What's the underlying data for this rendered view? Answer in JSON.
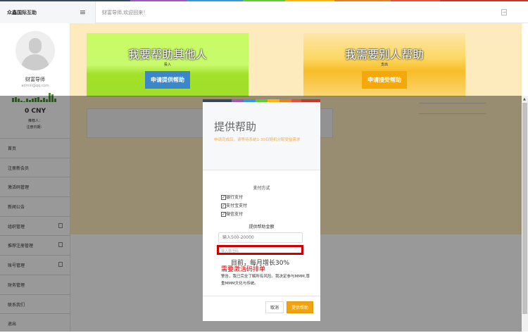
{
  "app": {
    "logo": "众鑫国际互助",
    "welcome": "财富导师,欢迎回来！"
  },
  "colors": {
    "stripe": [
      "#34495e",
      "#9b59b6",
      "#3498db",
      "#62cb31",
      "#ffb606",
      "#e67e22",
      "#e74c3c",
      "#c0392b"
    ],
    "green_button": "#3b87c9",
    "orange_button": "#f5a80a"
  },
  "user": {
    "name": "财富导师",
    "email": "admin@qq.com",
    "balance": "0 CNY",
    "referrer": "推荐人：",
    "reg_date": "注册日期：",
    "activity_bars": [
      5,
      6,
      4,
      1,
      0,
      4,
      2,
      4,
      5,
      6,
      2,
      5,
      3,
      12,
      10,
      4
    ]
  },
  "sidebar": {
    "items": [
      {
        "label": "首页"
      },
      {
        "label": "注册新会员"
      },
      {
        "label": "激活码管理"
      },
      {
        "label": "新闻公告"
      },
      {
        "label": "组织管理",
        "badge": true
      },
      {
        "label": "推荐注册管理",
        "badge": true
      },
      {
        "label": "账号管理",
        "badge": true
      },
      {
        "label": "财务管理"
      },
      {
        "label": "联系我们"
      },
      {
        "label": "退出"
      }
    ]
  },
  "cards": {
    "give": {
      "title": "我要帮助其他人",
      "sub": "投入",
      "button": "申请提供帮助"
    },
    "get": {
      "title": "我需要别人帮助",
      "sub": "支出",
      "button": "申请接受帮助"
    }
  },
  "modal": {
    "title": "提供帮助",
    "notice": "申请完成后，请等待系统1-30日随机分配受益需求",
    "payment_title": "支付方式",
    "payments": [
      {
        "label": "银行支付",
        "checked": true
      },
      {
        "label": "支付宝支付",
        "checked": true
      },
      {
        "label": "微信支付",
        "checked": true
      }
    ],
    "amount_label": "提供帮助金额",
    "amount_placeholder": "输入500-20000",
    "code_placeholder": "输入激活码",
    "growth": "目前，每月增长30%",
    "need_code": "需要激活码排单",
    "warning": "警告，我已完全了解所有风险。我决定参与MMM,尊重MMM文化与传统。",
    "cancel": "取消",
    "submit": "提供帮助"
  }
}
